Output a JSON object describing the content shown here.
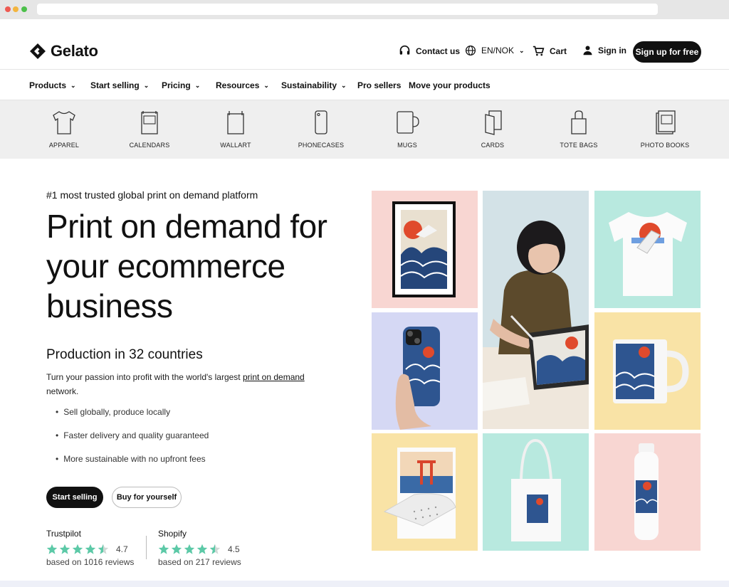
{
  "brand": {
    "name": "Gelato"
  },
  "header": {
    "contact": "Contact us",
    "language": "EN/NOK",
    "cart": "Cart",
    "signin": "Sign in",
    "signup": "Sign up for free"
  },
  "nav": [
    {
      "label": "Products",
      "has_menu": true
    },
    {
      "label": "Start selling",
      "has_menu": true
    },
    {
      "label": "Pricing",
      "has_menu": true
    },
    {
      "label": "Resources",
      "has_menu": true
    },
    {
      "label": "Sustainability",
      "has_menu": true
    },
    {
      "label": "Pro sellers",
      "has_menu": false
    },
    {
      "label": "Move your products",
      "has_menu": false
    }
  ],
  "categories": [
    {
      "label": "APPAREL",
      "icon": "tshirt-icon"
    },
    {
      "label": "CALENDARS",
      "icon": "calendar-icon"
    },
    {
      "label": "WALLART",
      "icon": "frame-icon"
    },
    {
      "label": "PHONECASES",
      "icon": "phone-icon"
    },
    {
      "label": "MUGS",
      "icon": "mug-icon"
    },
    {
      "label": "CARDS",
      "icon": "cards-icon"
    },
    {
      "label": "TOTE BAGS",
      "icon": "tote-bag-icon"
    },
    {
      "label": "PHOTO BOOKS",
      "icon": "photo-book-icon"
    }
  ],
  "hero": {
    "eyebrow": "#1 most trusted global print on demand platform",
    "title": "Print on demand for your ecommerce business",
    "subtitle": "Production in 32 countries",
    "desc_prefix": "Turn your passion into profit with the world's largest ",
    "desc_link": "print on demand",
    "desc_suffix": " network.",
    "bullets": [
      "Sell globally, produce locally",
      "Faster delivery and quality guaranteed",
      "More sustainable with no upfront fees"
    ],
    "cta_primary": "Start selling",
    "cta_secondary": "Buy for yourself"
  },
  "ratings": [
    {
      "name": "Trustpilot",
      "score": "4.7",
      "reviews": "based on 1016 reviews"
    },
    {
      "name": "Shopify",
      "score": "4.5",
      "reviews": "based on 217 reviews"
    }
  ],
  "colors": {
    "accent": "#111111",
    "star": "#5cc9a7",
    "tile_pink": "#f8d6d2",
    "tile_mint": "#b8e9df",
    "tile_lavender": "#d5d8f4",
    "tile_yellow": "#f9e3a6"
  }
}
